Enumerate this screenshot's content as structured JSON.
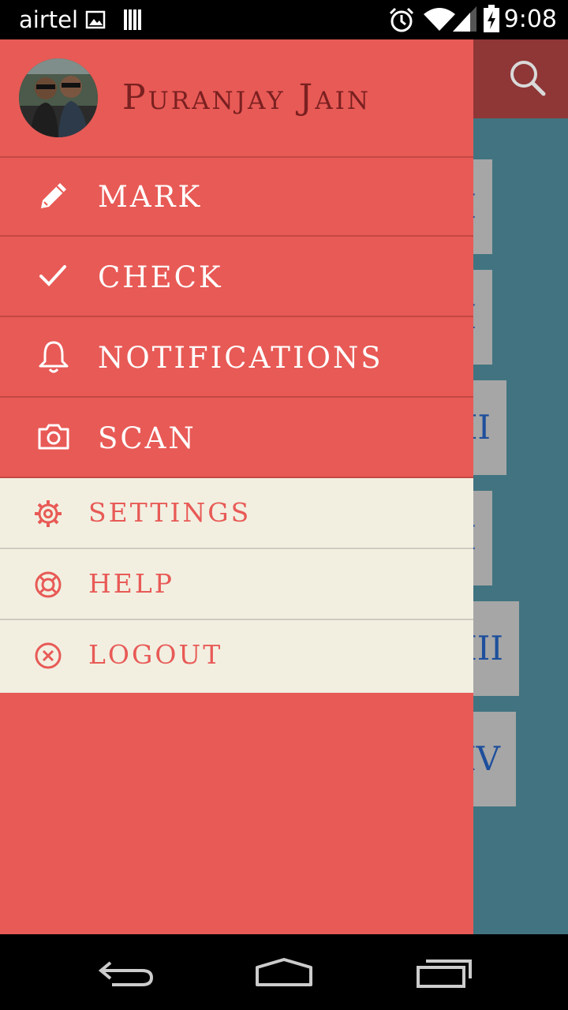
{
  "status_bar": {
    "carrier": "airtel",
    "time": "9:08",
    "icons": [
      "image-icon",
      "barcode-icon",
      "alarm-icon",
      "wifi-icon",
      "signal-icon",
      "battery-charging-icon"
    ]
  },
  "background_app": {
    "cards": [
      "I",
      "I",
      "II",
      "I",
      "III",
      "IV"
    ],
    "search_icon": "search-icon"
  },
  "drawer": {
    "user_name": "Puranjay Jain",
    "primary_items": [
      {
        "label": "MARK",
        "icon": "pencil-icon"
      },
      {
        "label": "CHECK",
        "icon": "check-icon"
      },
      {
        "label": "NOTIFICATIONS",
        "icon": "bell-icon"
      },
      {
        "label": "SCAN",
        "icon": "camera-icon"
      }
    ],
    "secondary_items": [
      {
        "label": "SETTINGS",
        "icon": "gear-icon"
      },
      {
        "label": "HELP",
        "icon": "lifebuoy-icon"
      },
      {
        "label": "LOGOUT",
        "icon": "close-circle-icon"
      }
    ]
  },
  "nav_bar": {
    "buttons": [
      "back-icon",
      "home-icon",
      "recents-icon"
    ]
  },
  "colors": {
    "drawer_red": "#e85a56",
    "toolbar_dark_red": "#8f3636",
    "app_teal": "#417480",
    "secondary_bg": "#f2efe1",
    "card_grey": "#a6a6a6",
    "card_text_blue": "#1e4f9c"
  }
}
